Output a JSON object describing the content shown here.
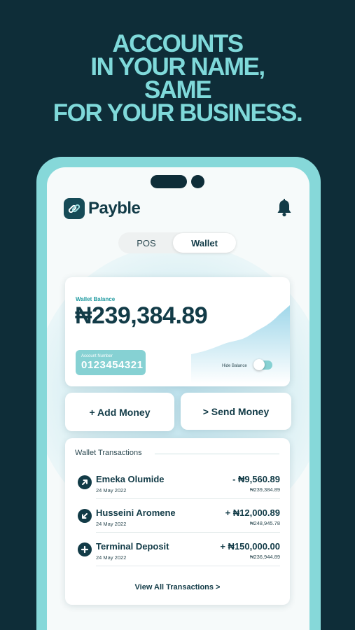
{
  "headline": {
    "line1": "ACCOUNTS",
    "line2": "IN YOUR NAME,",
    "line3": "SAME",
    "line4": "FOR YOUR BUSINESS."
  },
  "app": {
    "name": "Payble",
    "logo_icon": "link-icon",
    "notification_icon": "bell-icon"
  },
  "tabs": {
    "pos": "POS",
    "wallet": "Wallet",
    "selected": "Wallet"
  },
  "balance_card": {
    "label": "Wallet Balance",
    "amount": "₦239,384.89",
    "account_label": "Account Number",
    "account_number": "0123454321",
    "hide_label": "Hide Balance",
    "hide_enabled": false
  },
  "actions": {
    "add_money": "+ Add Money",
    "send_money": "> Send Money"
  },
  "transactions": {
    "title": "Wallet Transactions",
    "items": [
      {
        "name": "Emeka Olumide",
        "date": "24 May 2022",
        "amount": "- ₦9,560.89",
        "balance": "₦239,384.89",
        "icon": "arrow-up-right-icon"
      },
      {
        "name": "Husseini Aromene",
        "date": "24 May 2022",
        "amount": "+ ₦12,000.89",
        "balance": "₦248,945.78",
        "icon": "arrow-down-left-icon"
      },
      {
        "name": "Terminal Deposit",
        "date": "24 May 2022",
        "amount": "+ ₦150,000.00",
        "balance": "₦236,944.89",
        "icon": "plus-icon"
      }
    ],
    "view_all": "View All Transactions >"
  },
  "colors": {
    "background": "#0e2d38",
    "accent": "#86d8d9",
    "headline": "#7fd9da",
    "ink": "#123b47"
  }
}
